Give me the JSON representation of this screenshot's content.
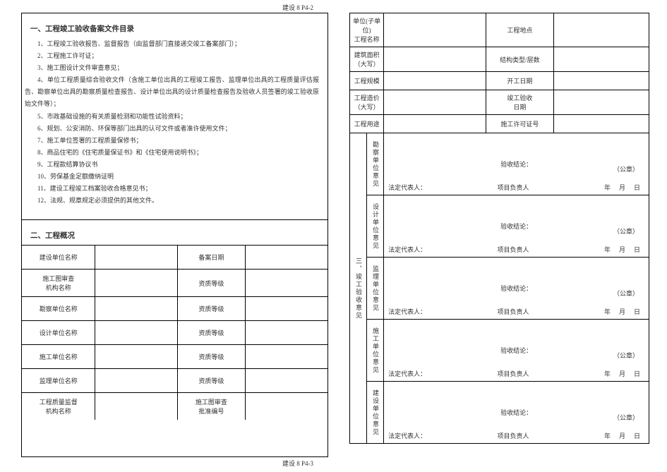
{
  "page_code_top": "建设 8    P4-2",
  "page_code_bottom": "建设 8    P4-3",
  "section1_title": "一、工程竣工验收备案文件目录",
  "list_items": [
    "1、工程竣工验收报告、监督报告（由监督部门直接递交竣工备案部门）；",
    "2、工程施工许可证；",
    "3、施工图设计文件审查意见；",
    "4、单位工程质量综合验收文件（含施工单位出具的工程竣工报告、监理单位出具的工程质量评估报告、勘察单位出具的勘察质量检查报告、设计单位出具的设计质量检查报告及验收人员签署的竣工验收原始文件等）；",
    "5、市政基础设施的有关质量检测和功能性试验资料；",
    "6、规划、公安消防、环保等部门出具的认可文件或者准许使用文件；",
    "7、施工单位签署的工程质量保修书；",
    "8、商品住宅的《住宅质量保证书》和《住宅使用说明书》；",
    "9、工程款结算协议书",
    "10、劳保基金足额缴纳证明",
    "11、建设工程竣工档案验收合格意见书；",
    "12、法规、规章规定必须提供的其他文件。"
  ],
  "section2_title": "二、工程概况",
  "overview_rows": [
    {
      "l": "建设单位名称",
      "r": "备案日期"
    },
    {
      "l": "施工图审查\n机构名称",
      "r": "资质等级"
    },
    {
      "l": "勘察单位名称",
      "r": "资质等级"
    },
    {
      "l": "设计单位名称",
      "r": "资质等级"
    },
    {
      "l": "施工单位名称",
      "r": "资质等级"
    },
    {
      "l": "监理单位名称",
      "r": "资质等级"
    },
    {
      "l": "工程质量监督\n机构名称",
      "r": "施工图审查\n批准编号"
    }
  ],
  "right_header_rows": [
    {
      "l": "单位(子单位)\n工程名称",
      "r": "工程地点"
    },
    {
      "l": "建筑面积\n（大写）",
      "r": "结构类型/层数"
    },
    {
      "l": "工程规模",
      "r": "开工日期"
    },
    {
      "l": "工程造价\n（大写）",
      "r": "竣工验收\n日期"
    },
    {
      "l": "工程用途",
      "r": "施工许可证号"
    }
  ],
  "section3_title": "三、竣工验收意见",
  "opinion_groups": [
    "勘察单位意见",
    "设计单位意见",
    "监理单位意见",
    "施工单位意见",
    "建设单位意见"
  ],
  "opinion_labels": {
    "conclusion": "验收结论：",
    "seal": "（公章）",
    "legal_rep": "法定代表人：",
    "proj_lead": "项目负责人",
    "y": "年",
    "m": "月",
    "d": "日"
  }
}
